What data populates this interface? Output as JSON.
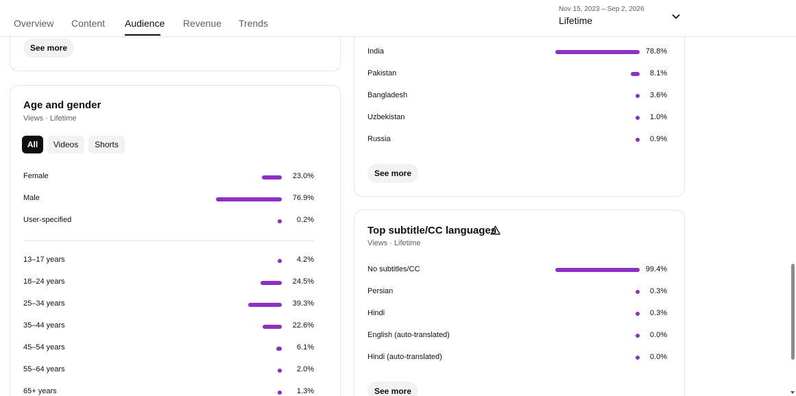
{
  "tabs": [
    {
      "label": "Overview"
    },
    {
      "label": "Content"
    },
    {
      "label": "Audience"
    },
    {
      "label": "Revenue"
    },
    {
      "label": "Trends"
    }
  ],
  "date_picker": {
    "range": "Nov 15, 2023 – Sep 2, 2026",
    "label": "Lifetime"
  },
  "top_card": {
    "see_more": "See more"
  },
  "age_gender": {
    "title": "Age and gender",
    "subtitle": "Views · Lifetime",
    "filters": [
      "All",
      "Videos",
      "Shorts"
    ],
    "gender_rows": [
      {
        "label": "Female",
        "value": "23.0%",
        "pct": 23.0
      },
      {
        "label": "Male",
        "value": "76.9%",
        "pct": 76.9
      },
      {
        "label": "User-specified",
        "value": "0.2%",
        "pct": 0.2
      }
    ],
    "age_rows": [
      {
        "label": "13–17 years",
        "value": "4.2%",
        "pct": 4.2
      },
      {
        "label": "18–24 years",
        "value": "24.5%",
        "pct": 24.5
      },
      {
        "label": "25–34 years",
        "value": "39.3%",
        "pct": 39.3
      },
      {
        "label": "35–44 years",
        "value": "22.6%",
        "pct": 22.6
      },
      {
        "label": "45–54 years",
        "value": "6.1%",
        "pct": 6.1
      },
      {
        "label": "55–64 years",
        "value": "2.0%",
        "pct": 2.0
      },
      {
        "label": "65+ years",
        "value": "1.3%",
        "pct": 1.3
      }
    ]
  },
  "geography": {
    "rows": [
      {
        "label": "India",
        "value": "78.8%",
        "pct": 78.8
      },
      {
        "label": "Pakistan",
        "value": "8.1%",
        "pct": 8.1
      },
      {
        "label": "Bangladesh",
        "value": "3.6%",
        "pct": 3.6
      },
      {
        "label": "Uzbekistan",
        "value": "1.0%",
        "pct": 1.0
      },
      {
        "label": "Russia",
        "value": "0.9%",
        "pct": 0.9
      }
    ],
    "see_more": "See more"
  },
  "subtitles": {
    "title": "Top subtitle/CC languages",
    "subtitle": "Views · Lifetime",
    "rows": [
      {
        "label": "No subtitles/CC",
        "value": "99.4%",
        "pct": 99.4
      },
      {
        "label": "Persian",
        "value": "0.3%",
        "pct": 0.3
      },
      {
        "label": "Hindi",
        "value": "0.3%",
        "pct": 0.3
      },
      {
        "label": "English (auto-translated)",
        "value": "0.0%",
        "pct": 0.0
      },
      {
        "label": "Hindi (auto-translated)",
        "value": "0.0%",
        "pct": 0.0
      }
    ],
    "see_more": "See more"
  },
  "colors": {
    "bar": "#8c30c6",
    "accent": "#0f0f0f"
  }
}
